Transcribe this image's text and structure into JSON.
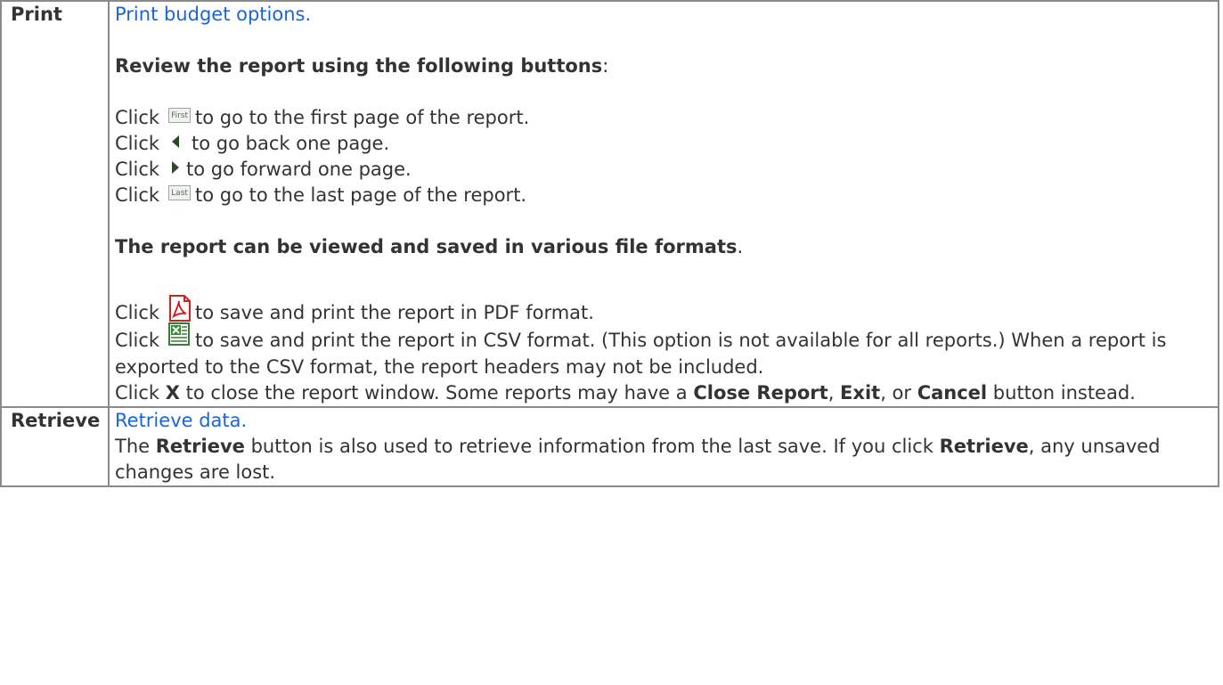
{
  "rows": {
    "print": {
      "label": "Print",
      "link": "Print budget options.",
      "review_heading": "Review the report using the following buttons",
      "colon": ":",
      "nav_lines": [
        {
          "pre": "Click",
          "post": "to go to the first page of the report.",
          "icon": "first-page-button-icon",
          "icon_text": "First"
        },
        {
          "pre": "Click",
          "post": "to go back one page.",
          "icon": "previous-arrow-icon"
        },
        {
          "pre": "Click",
          "post": "to go forward one page.",
          "icon": "next-arrow-icon"
        },
        {
          "pre": "Click",
          "post": "to go to the last page of the report.",
          "icon": "last-page-button-icon",
          "icon_text": "Last"
        }
      ],
      "formats_heading": "The report can be viewed and saved in various file formats",
      "period": ".",
      "pdf_line": {
        "pre": "Click",
        "post": "to save and print the report in PDF format.",
        "icon": "pdf-icon"
      },
      "csv_line": {
        "pre": "Click",
        "post": "to save and print the report in CSV format. (This option is not available for all reports.) When a report is exported to the CSV format, the report headers may not be included.",
        "icon": "excel-csv-icon"
      },
      "close_line": {
        "pre": "Click ",
        "x": "X",
        "mid1": " to close the report window. Some reports may have a ",
        "close_report": "Close Report",
        "comma1": ", ",
        "exit": "Exit",
        "mid2": ", or ",
        "cancel": "Cancel",
        "post": " button instead."
      }
    },
    "retrieve": {
      "label": "Retrieve",
      "link": "Retrieve data.",
      "pre": "The ",
      "bold1": "Retrieve",
      "mid": " button is also used to retrieve information from the last save. If you click ",
      "bold2": "Retrieve",
      "post": ", any unsaved changes are lost."
    }
  }
}
